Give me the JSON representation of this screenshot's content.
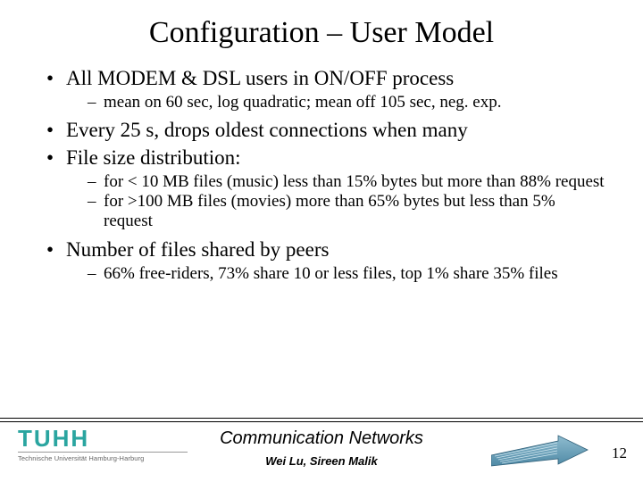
{
  "title": "Configuration – User Model",
  "bullets": {
    "b1": "All MODEM & DSL users in ON/OFF process",
    "b1_s1": "mean on 60 sec, log quadratic; mean off 105 sec, neg. exp.",
    "b2": "Every 25 s, drops oldest connections when many",
    "b3": "File size distribution:",
    "b3_s1": "for < 10 MB files (music) less than 15% bytes but more than 88% request",
    "b3_s2": "for >100 MB files (movies) more than 65% bytes but less than 5% request",
    "b4": "Number of files shared by peers",
    "b4_s1": "66% free-riders, 73% share 10 or less files, top 1% share 35% files"
  },
  "footer": {
    "logo_main": "TUHH",
    "logo_sub": "Technische Universität Hamburg-Harburg",
    "center_title": "Communication Networks",
    "authors": "Wei Lu, Sireen Malik",
    "page": "12"
  }
}
